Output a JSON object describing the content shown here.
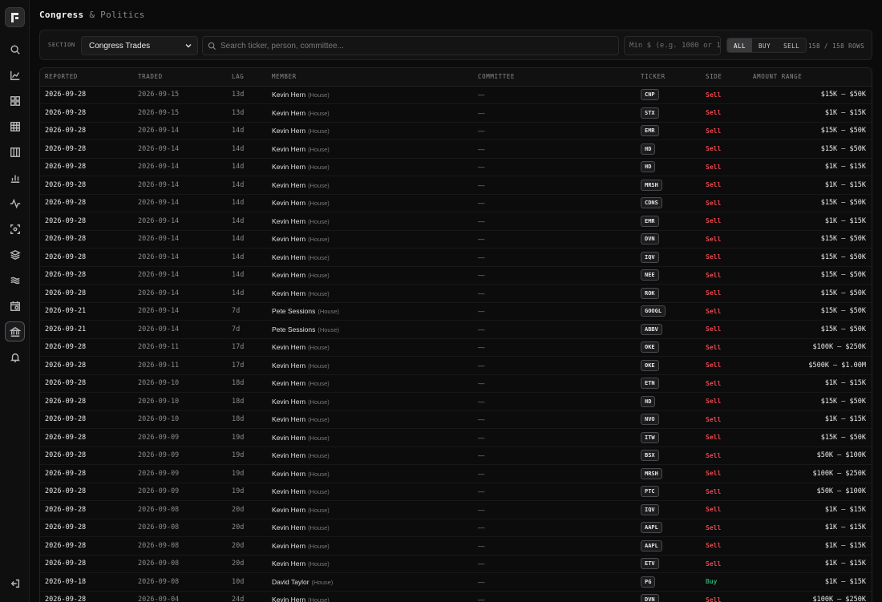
{
  "page": {
    "title_main": "Congress",
    "title_sub": "& Politics"
  },
  "sidebar": {
    "items": [
      {
        "name": "search-icon"
      },
      {
        "name": "chart-icon"
      },
      {
        "name": "dashboard-icon"
      },
      {
        "name": "grid-icon"
      },
      {
        "name": "columns-icon"
      },
      {
        "name": "bar-chart-icon"
      },
      {
        "name": "pulse-icon"
      },
      {
        "name": "scan-icon"
      },
      {
        "name": "layers-icon"
      },
      {
        "name": "waves-icon"
      },
      {
        "name": "calendar-icon"
      },
      {
        "name": "bank-icon",
        "active": true
      },
      {
        "name": "bell-icon"
      }
    ],
    "bottom": "logout-icon"
  },
  "toolbar": {
    "section_label": "SECTION",
    "section_value": "Congress Trades",
    "search_placeholder": "Search ticker, person, committee...",
    "min_placeholder": "Min $ (e.g. 1000 or 1",
    "filters": [
      "ALL",
      "BUY",
      "SELL"
    ],
    "active_filter": "ALL",
    "rows_count": "158 / 158 ROWS"
  },
  "table": {
    "columns": [
      "REPORTED",
      "TRADED",
      "LAG",
      "MEMBER",
      "COMMITTEE",
      "TICKER",
      "SIDE",
      "AMOUNT RANGE"
    ],
    "rows": [
      {
        "reported": "2026-09-28",
        "traded": "2026-09-15",
        "lag": "13d",
        "member": "Kevin Hern",
        "chamber": "(House)",
        "committee": "—",
        "ticker": "CNP",
        "side": "Sell",
        "amount": "$15K – $50K"
      },
      {
        "reported": "2026-09-28",
        "traded": "2026-09-15",
        "lag": "13d",
        "member": "Kevin Hern",
        "chamber": "(House)",
        "committee": "—",
        "ticker": "STX",
        "side": "Sell",
        "amount": "$1K – $15K"
      },
      {
        "reported": "2026-09-28",
        "traded": "2026-09-14",
        "lag": "14d",
        "member": "Kevin Hern",
        "chamber": "(House)",
        "committee": "—",
        "ticker": "EMR",
        "side": "Sell",
        "amount": "$15K – $50K"
      },
      {
        "reported": "2026-09-28",
        "traded": "2026-09-14",
        "lag": "14d",
        "member": "Kevin Hern",
        "chamber": "(House)",
        "committee": "—",
        "ticker": "HD",
        "side": "Sell",
        "amount": "$15K – $50K"
      },
      {
        "reported": "2026-09-28",
        "traded": "2026-09-14",
        "lag": "14d",
        "member": "Kevin Hern",
        "chamber": "(House)",
        "committee": "—",
        "ticker": "HD",
        "side": "Sell",
        "amount": "$1K – $15K"
      },
      {
        "reported": "2026-09-28",
        "traded": "2026-09-14",
        "lag": "14d",
        "member": "Kevin Hern",
        "chamber": "(House)",
        "committee": "—",
        "ticker": "MRSH",
        "side": "Sell",
        "amount": "$1K – $15K"
      },
      {
        "reported": "2026-09-28",
        "traded": "2026-09-14",
        "lag": "14d",
        "member": "Kevin Hern",
        "chamber": "(House)",
        "committee": "—",
        "ticker": "CDNS",
        "side": "Sell",
        "amount": "$15K – $50K"
      },
      {
        "reported": "2026-09-28",
        "traded": "2026-09-14",
        "lag": "14d",
        "member": "Kevin Hern",
        "chamber": "(House)",
        "committee": "—",
        "ticker": "EMR",
        "side": "Sell",
        "amount": "$1K – $15K"
      },
      {
        "reported": "2026-09-28",
        "traded": "2026-09-14",
        "lag": "14d",
        "member": "Kevin Hern",
        "chamber": "(House)",
        "committee": "—",
        "ticker": "DVN",
        "side": "Sell",
        "amount": "$15K – $50K"
      },
      {
        "reported": "2026-09-28",
        "traded": "2026-09-14",
        "lag": "14d",
        "member": "Kevin Hern",
        "chamber": "(House)",
        "committee": "—",
        "ticker": "IQV",
        "side": "Sell",
        "amount": "$15K – $50K"
      },
      {
        "reported": "2026-09-28",
        "traded": "2026-09-14",
        "lag": "14d",
        "member": "Kevin Hern",
        "chamber": "(House)",
        "committee": "—",
        "ticker": "NEE",
        "side": "Sell",
        "amount": "$15K – $50K"
      },
      {
        "reported": "2026-09-28",
        "traded": "2026-09-14",
        "lag": "14d",
        "member": "Kevin Hern",
        "chamber": "(House)",
        "committee": "—",
        "ticker": "ROK",
        "side": "Sell",
        "amount": "$15K – $50K"
      },
      {
        "reported": "2026-09-21",
        "traded": "2026-09-14",
        "lag": "7d",
        "member": "Pete Sessions",
        "chamber": "(House)",
        "committee": "—",
        "ticker": "GOOGL",
        "side": "Sell",
        "amount": "$15K – $50K"
      },
      {
        "reported": "2026-09-21",
        "traded": "2026-09-14",
        "lag": "7d",
        "member": "Pete Sessions",
        "chamber": "(House)",
        "committee": "—",
        "ticker": "ABBV",
        "side": "Sell",
        "amount": "$15K – $50K"
      },
      {
        "reported": "2026-09-28",
        "traded": "2026-09-11",
        "lag": "17d",
        "member": "Kevin Hern",
        "chamber": "(House)",
        "committee": "—",
        "ticker": "OKE",
        "side": "Sell",
        "amount": "$100K – $250K"
      },
      {
        "reported": "2026-09-28",
        "traded": "2026-09-11",
        "lag": "17d",
        "member": "Kevin Hern",
        "chamber": "(House)",
        "committee": "—",
        "ticker": "OKE",
        "side": "Sell",
        "amount": "$500K – $1.00M"
      },
      {
        "reported": "2026-09-28",
        "traded": "2026-09-10",
        "lag": "18d",
        "member": "Kevin Hern",
        "chamber": "(House)",
        "committee": "—",
        "ticker": "ETN",
        "side": "Sell",
        "amount": "$1K – $15K"
      },
      {
        "reported": "2026-09-28",
        "traded": "2026-09-10",
        "lag": "18d",
        "member": "Kevin Hern",
        "chamber": "(House)",
        "committee": "—",
        "ticker": "HD",
        "side": "Sell",
        "amount": "$15K – $50K"
      },
      {
        "reported": "2026-09-28",
        "traded": "2026-09-10",
        "lag": "18d",
        "member": "Kevin Hern",
        "chamber": "(House)",
        "committee": "—",
        "ticker": "NVO",
        "side": "Sell",
        "amount": "$1K – $15K"
      },
      {
        "reported": "2026-09-28",
        "traded": "2026-09-09",
        "lag": "19d",
        "member": "Kevin Hern",
        "chamber": "(House)",
        "committee": "—",
        "ticker": "ITW",
        "side": "Sell",
        "amount": "$15K – $50K"
      },
      {
        "reported": "2026-09-28",
        "traded": "2026-09-09",
        "lag": "19d",
        "member": "Kevin Hern",
        "chamber": "(House)",
        "committee": "—",
        "ticker": "BSX",
        "side": "Sell",
        "amount": "$50K – $100K"
      },
      {
        "reported": "2026-09-28",
        "traded": "2026-09-09",
        "lag": "19d",
        "member": "Kevin Hern",
        "chamber": "(House)",
        "committee": "—",
        "ticker": "MRSH",
        "side": "Sell",
        "amount": "$100K – $250K"
      },
      {
        "reported": "2026-09-28",
        "traded": "2026-09-09",
        "lag": "19d",
        "member": "Kevin Hern",
        "chamber": "(House)",
        "committee": "—",
        "ticker": "PTC",
        "side": "Sell",
        "amount": "$50K – $100K"
      },
      {
        "reported": "2026-09-28",
        "traded": "2026-09-08",
        "lag": "20d",
        "member": "Kevin Hern",
        "chamber": "(House)",
        "committee": "—",
        "ticker": "IQV",
        "side": "Sell",
        "amount": "$1K – $15K"
      },
      {
        "reported": "2026-09-28",
        "traded": "2026-09-08",
        "lag": "20d",
        "member": "Kevin Hern",
        "chamber": "(House)",
        "committee": "—",
        "ticker": "AAPL",
        "side": "Sell",
        "amount": "$1K – $15K"
      },
      {
        "reported": "2026-09-28",
        "traded": "2026-09-08",
        "lag": "20d",
        "member": "Kevin Hern",
        "chamber": "(House)",
        "committee": "—",
        "ticker": "AAPL",
        "side": "Sell",
        "amount": "$1K – $15K"
      },
      {
        "reported": "2026-09-28",
        "traded": "2026-09-08",
        "lag": "20d",
        "member": "Kevin Hern",
        "chamber": "(House)",
        "committee": "—",
        "ticker": "ETV",
        "side": "Sell",
        "amount": "$1K – $15K"
      },
      {
        "reported": "2026-09-18",
        "traded": "2026-09-08",
        "lag": "10d",
        "member": "David Taylor",
        "chamber": "(House)",
        "committee": "—",
        "ticker": "PG",
        "side": "Buy",
        "amount": "$1K – $15K"
      },
      {
        "reported": "2026-09-28",
        "traded": "2026-09-04",
        "lag": "24d",
        "member": "Kevin Hern",
        "chamber": "(House)",
        "committee": "—",
        "ticker": "DVN",
        "side": "Sell",
        "amount": "$100K – $250K"
      }
    ]
  },
  "colors": {
    "sell": "#e5484d",
    "buy": "#30a46c",
    "background": "#0b0b0c"
  }
}
